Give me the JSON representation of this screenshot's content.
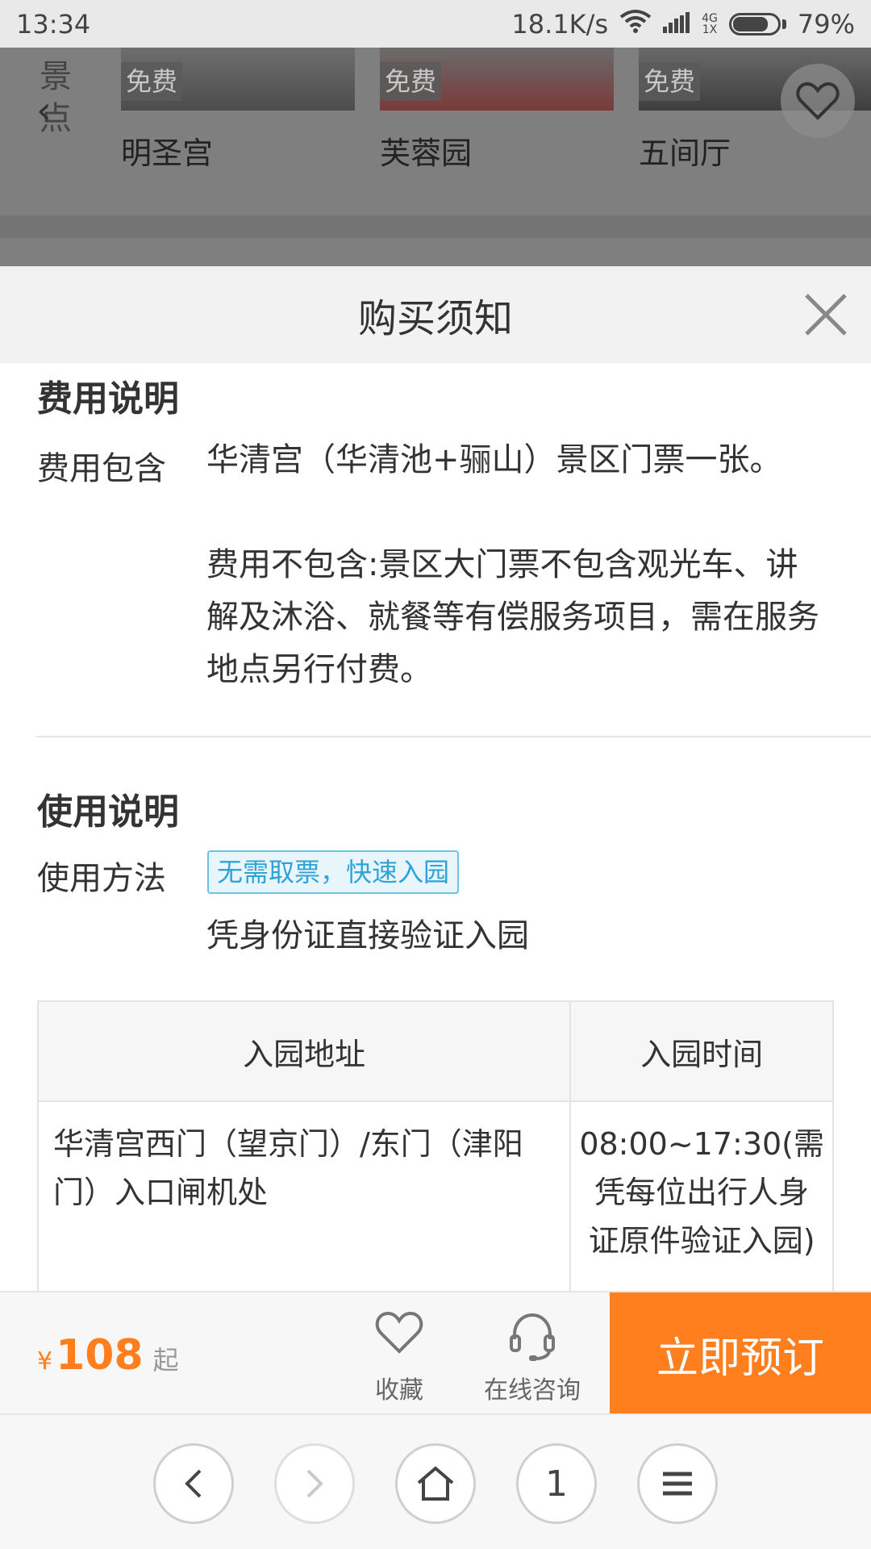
{
  "status": {
    "time": "13:34",
    "speed": "18.1K/s",
    "net_top": "4G",
    "net_bottom": "1X",
    "battery": "79%"
  },
  "background": {
    "side_label_chars": [
      "景",
      "点"
    ],
    "scenic": [
      {
        "badge": "免费",
        "name": "明圣宫"
      },
      {
        "badge": "免费",
        "name": "芙蓉园"
      },
      {
        "badge": "免费",
        "name": "五间厅"
      }
    ]
  },
  "sheet": {
    "title": "购买须知",
    "fee_section": {
      "title": "费用说明",
      "label": "费用包含",
      "text_included": "华清宫（华清池+骊山）景区门票一张。",
      "text_excluded": "费用不包含:景区大门票不包含观光车、讲解及沐浴、就餐等有偿服务项目，需在服务地点另行付费。"
    },
    "usage_section": {
      "title": "使用说明",
      "label": "使用方法",
      "tag": "无需取票，快速入园",
      "desc": "凭身份证直接验证入园"
    },
    "table": {
      "headers": [
        "入园地址",
        "入园时间"
      ],
      "rows": [
        {
          "address": "华清宫西门（望京门）/东门（津阳门）入口闸机处",
          "time": "08:00~17:30(需凭每位出行人身证原件验证入园)"
        }
      ]
    }
  },
  "booking": {
    "currency": "¥",
    "price": "108",
    "price_suffix": "起",
    "favorite_label": "收藏",
    "consult_label": "在线咨询",
    "book_label": "立即预订"
  },
  "nav": {
    "tab_count": "1"
  },
  "colors": {
    "accent": "#ff7f1f",
    "tag_blue": "#2ea3d7"
  }
}
